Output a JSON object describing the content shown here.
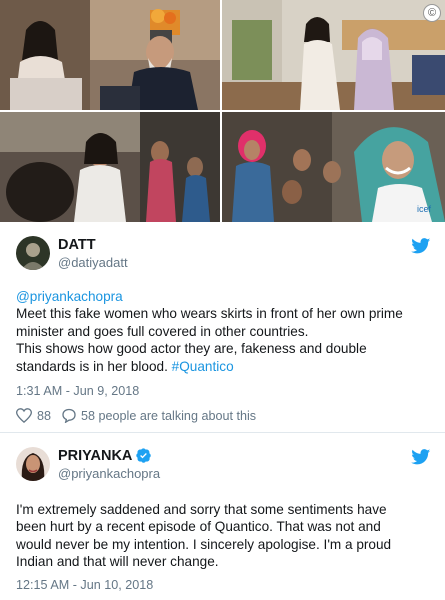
{
  "photo_watermark": "©",
  "tweet1": {
    "display_name": "DATT",
    "handle": "@datiyadatt",
    "mention": "@priyankachopra",
    "line1": "Meet this fake women who wears skirts in front of her own prime",
    "line2": "minister and goes full covered in other countries.",
    "line3": "This shows how good actor they are, fakeness and double",
    "line4_text": "standards is in her blood. ",
    "hashtag": "#Quantico",
    "timestamp": "1:31 AM - Jun 9, 2018",
    "like_count": "88",
    "talking": "58 people are talking about this"
  },
  "tweet2": {
    "display_name": "PRIYANKA",
    "handle": "@priyankachopra",
    "line1": "I'm extremely saddened and sorry that some sentiments have",
    "line2": "been hurt by a recent episode of Quantico. That was not and",
    "line3": "would never be my intention. I sincerely apologise. I'm a proud",
    "line4": "Indian and that will never change.",
    "timestamp": "12:15 AM - Jun 10, 2018"
  },
  "icons": {
    "twitter": "twitter-bird-icon",
    "heart": "heart-icon",
    "comment": "comment-bubble-icon",
    "verified": "verified-badge-icon"
  },
  "colors": {
    "twitter_blue": "#1da1f2",
    "link_blue": "#1b95e0",
    "meta_gray": "#657786",
    "divider": "#e1e8ed"
  }
}
